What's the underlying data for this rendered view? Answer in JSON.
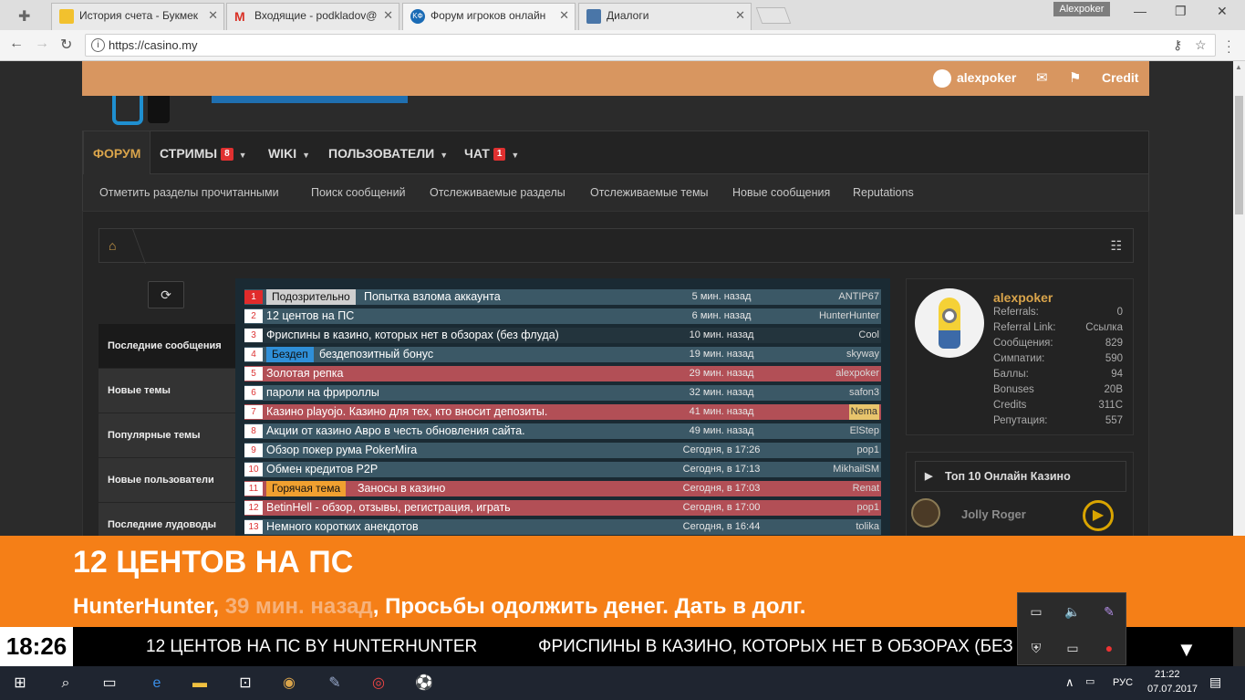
{
  "browser": {
    "tabs": [
      {
        "title": "История счета - Букмек",
        "active": false,
        "color": "#f2c12e"
      },
      {
        "title": "Входящие - podkladov@",
        "active": false,
        "color": "#d93025"
      },
      {
        "title": "Форум игроков онлайн",
        "active": true,
        "color": "#1a6bb5"
      },
      {
        "title": "Диалоги",
        "active": false,
        "color": "#4a76a8"
      }
    ],
    "profile_chip": "Alexpoker",
    "url": "https://casino.my"
  },
  "userbar": {
    "username": "alexpoker",
    "credit_label": "Credit"
  },
  "nav": {
    "items": [
      {
        "label": "ФОРУМ",
        "badge": "",
        "active": true
      },
      {
        "label": "СТРИМЫ",
        "badge": "8",
        "active": false
      },
      {
        "label": "WIKI",
        "badge": "",
        "active": false
      },
      {
        "label": "ПОЛЬЗОВАТЕЛИ",
        "badge": "",
        "active": false
      },
      {
        "label": "ЧАТ",
        "badge": "1",
        "active": false
      }
    ],
    "sub": [
      "Отметить разделы прочитанными",
      "Поиск сообщений",
      "Отслеживаемые разделы",
      "Отслеживаемые темы",
      "Новые сообщения",
      "Reputations"
    ]
  },
  "sidebar_tabs": [
    "Последние сообщения",
    "Новые темы",
    "Популярные темы",
    "Новые пользователи",
    "Последние лудоводы"
  ],
  "threads": [
    {
      "n": "1",
      "tag": "Подозрительно",
      "tag_color": "#cfcfcf",
      "title": "Попытка взлома аккаунта",
      "time": "5 мин. назад",
      "author": "ANTIP67",
      "style": "blue",
      "hot": true
    },
    {
      "n": "2",
      "tag": "",
      "title": "12 центов на ПС",
      "time": "6 мин. назад",
      "author": "HunterHunter",
      "style": "blue"
    },
    {
      "n": "3",
      "tag": "",
      "title": "Фриспины в казино, которых нет в обзорах (без флуда)",
      "time": "10 мин. назад",
      "author": "Cool",
      "style": "dark"
    },
    {
      "n": "4",
      "tag": "Бездеп",
      "tag_color": "#2f8fd8",
      "title": "бездепозитный бонус",
      "time": "19 мин. назад",
      "author": "skyway",
      "style": "blue"
    },
    {
      "n": "5",
      "tag": "",
      "title": "Золотая репка",
      "time": "29 мин. назад",
      "author": "alexpoker",
      "style": "red"
    },
    {
      "n": "6",
      "tag": "",
      "title": "пароли на фрироллы",
      "time": "32 мин. назад",
      "author": "safon3",
      "style": "blue"
    },
    {
      "n": "7",
      "tag": "",
      "title": "Казино playojo. Казино для тех, кто вносит депозиты.",
      "time": "41 мин. назад",
      "author": "Nema",
      "style": "red",
      "hl": true
    },
    {
      "n": "8",
      "tag": "",
      "title": "Акции от казино Авро в честь обновления сайта.",
      "time": "49 мин. назад",
      "author": "ElStep",
      "style": "blue"
    },
    {
      "n": "9",
      "tag": "",
      "title": "Обзор покер рума PokerMira",
      "time": "Сегодня, в 17:26",
      "author": "pop1",
      "style": "blue"
    },
    {
      "n": "10",
      "tag": "",
      "title": "Обмен кредитов P2P",
      "time": "Сегодня, в 17:13",
      "author": "MikhailSM",
      "style": "blue"
    },
    {
      "n": "11",
      "tag": "Горячая тема",
      "tag_color": "#f0a030",
      "title": "Заносы в казино",
      "time": "Сегодня, в 17:03",
      "author": "Renat",
      "style": "red"
    },
    {
      "n": "12",
      "tag": "",
      "title": "BetinHell - обзор, отзывы, регистрация, играть",
      "time": "Сегодня, в 17:00",
      "author": "pop1",
      "style": "red"
    },
    {
      "n": "13",
      "tag": "",
      "title": "Немного коротких анекдотов",
      "time": "Сегодня, в 16:44",
      "author": "tolika",
      "style": "blue"
    }
  ],
  "profile": {
    "name": "alexpoker",
    "stats": [
      {
        "label": "Referrals:",
        "value": "0"
      },
      {
        "label": "Referral Link:",
        "value": "Ссылка"
      },
      {
        "label": "Сообщения:",
        "value": "829"
      },
      {
        "label": "Симпатии:",
        "value": "590"
      },
      {
        "label": "Баллы:",
        "value": "94"
      },
      {
        "label": "Bonuses",
        "value": "20B"
      },
      {
        "label": "Credits",
        "value": "311C"
      },
      {
        "label": "Репутация:",
        "value": "557"
      }
    ]
  },
  "casino": {
    "header": "Топ 10 Онлайн Казино",
    "name": "Jolly Roger"
  },
  "notification": {
    "title": "12 ЦЕНТОВ НА ПС",
    "author": "HunterHunter",
    "ago": "39 мин. назад",
    "text": "Просьбы одолжить денег. Дать в долг."
  },
  "ticker": {
    "clock": "18:26",
    "items": [
      "12 ЦЕНТОВ НА ПС BY HUNTERHUNTER",
      "ФРИСПИНЫ В КАЗИНО, КОТОРЫХ НЕТ В ОБЗОРАХ (БЕЗ ФЛУДА) B"
    ]
  },
  "taskbar": {
    "lang": "РУС",
    "time": "21:22",
    "date": "07.07.2017"
  }
}
